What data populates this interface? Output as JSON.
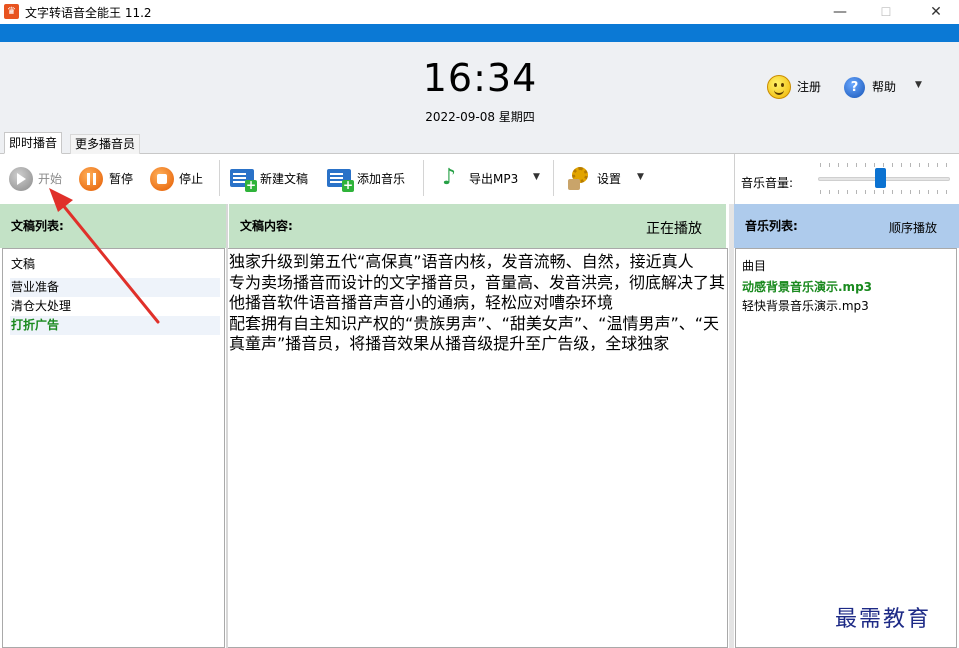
{
  "window": {
    "title": "文字转语音全能王 11.2",
    "minimize": "—",
    "maximize": "☐",
    "close": "✕"
  },
  "header": {
    "time": "16:34",
    "date": "2022-09-08 星期四",
    "register_label": "注册",
    "help_label": "帮助"
  },
  "tabs": [
    {
      "label": "即时播音",
      "active": true
    },
    {
      "label": "更多播音员",
      "active": false
    }
  ],
  "toolbar": {
    "start": "开始",
    "pause": "暂停",
    "stop": "停止",
    "new_doc": "新建文稿",
    "add_music": "添加音乐",
    "export_mp3": "导出MP3",
    "settings": "设置",
    "music_volume": "音乐音量:",
    "music_volume_level": 0.47
  },
  "doc_list": {
    "title": "文稿列表:",
    "items": [
      {
        "label": "文稿"
      },
      {
        "label": "营业准备"
      },
      {
        "label": "清仓大处理"
      },
      {
        "label": "打折广告",
        "active": true
      }
    ]
  },
  "doc_content": {
    "title": "文稿内容:",
    "status": "正在播放",
    "paragraphs": [
      "独家升级到第五代“高保真”语音内核，发音流畅、自然，接近真人",
      "专为卖场播音而设计的文字播音员，音量高、发音洪亮，彻底解决了其他播音软件语音播音声音小的通病，轻松应对嘈杂环境",
      "配套拥有自主知识产权的“贵族男声”、“甜美女声”、“温情男声”、“天真童声”播音员，将播音效果从播音级提升至广告级，全球独家"
    ]
  },
  "music_list": {
    "title": "音乐列表:",
    "mode": "顺序播放",
    "items": [
      {
        "label": "曲目"
      },
      {
        "label": "动感背景音乐演示.mp3",
        "active": true
      },
      {
        "label": "轻快背景音乐演示.mp3"
      }
    ]
  },
  "watermark": "最需教育",
  "colors": {
    "accent_blue": "#0b79d5",
    "panel_green": "#c3e2c6",
    "panel_blue": "#aecbec",
    "active_green": "#1a8a1f",
    "annotation_red": "#e0302a"
  }
}
